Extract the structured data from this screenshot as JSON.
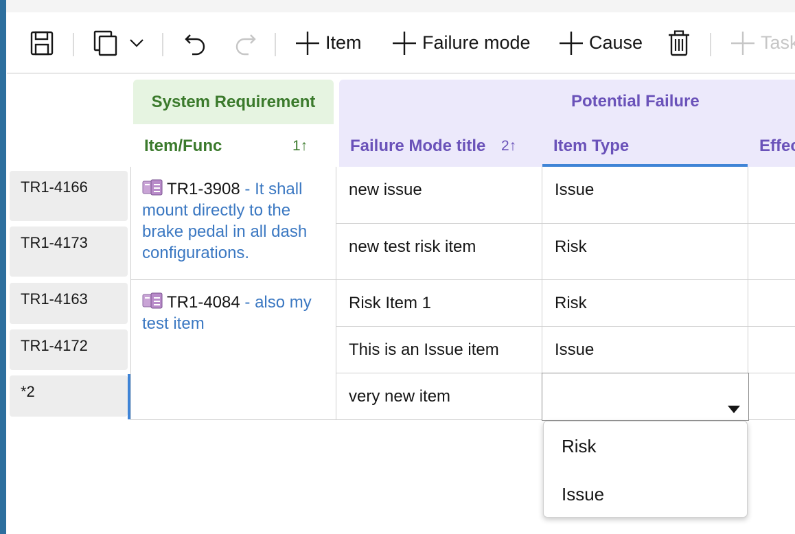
{
  "toolbar": {
    "item_label": "Item",
    "failure_mode_label": "Failure mode",
    "cause_label": "Cause",
    "task_label": "Task"
  },
  "groups": {
    "system_requirement": "System Requirement",
    "potential_failure": "Potential Failure"
  },
  "columns": {
    "item_func": "Item/Func",
    "item_func_sort": "1↑",
    "failure_mode_title": "Failure Mode title",
    "failure_mode_sort": "2↑",
    "item_type": "Item Type",
    "effect": "Effect"
  },
  "rows": [
    {
      "id": "TR1-4166",
      "failure_mode": "new issue",
      "item_type": "Issue"
    },
    {
      "id": "TR1-4173",
      "failure_mode": "new test risk item",
      "item_type": "Risk"
    },
    {
      "id": "TR1-4163",
      "failure_mode": "Risk Item 1",
      "item_type": "Risk"
    },
    {
      "id": "TR1-4172",
      "failure_mode": "This is an Issue item",
      "item_type": "Issue"
    },
    {
      "id": "*2",
      "failure_mode": "very new item",
      "item_type": ""
    }
  ],
  "requirements": [
    {
      "id": "TR1-3908",
      "desc": " - It shall mount directly to the brake pedal in all dash configurations."
    },
    {
      "id": "TR1-4084",
      "desc": " - also my test item"
    }
  ],
  "dropdown": {
    "options": [
      "Risk",
      "Issue"
    ]
  },
  "icons": [
    "save-icon",
    "copy-icon",
    "chevron-down-icon",
    "undo-icon",
    "redo-icon",
    "plus-icon",
    "trash-icon",
    "requirement-icon"
  ],
  "colors": {
    "green_header": "#3b7a2c",
    "purple_header": "#6a52b9",
    "link_blue": "#3b78c2",
    "accent_blue": "#3f84d6"
  }
}
